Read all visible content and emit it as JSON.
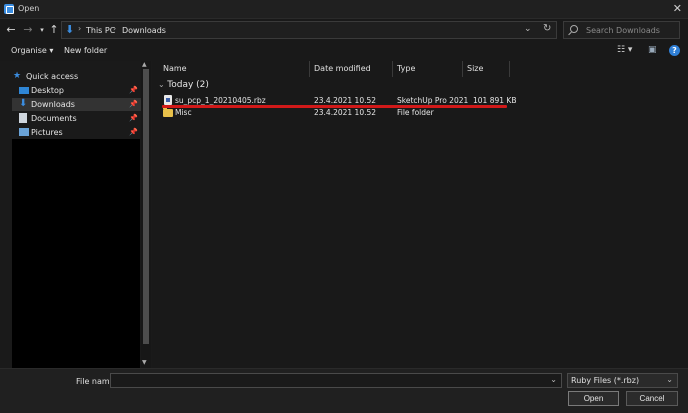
{
  "window": {
    "title": "Open"
  },
  "address": {
    "segments": [
      "This PC",
      "Downloads"
    ]
  },
  "search": {
    "placeholder": "Search Downloads"
  },
  "toolbar": {
    "organise": "Organise ▾",
    "new_folder": "New folder"
  },
  "sidebar": {
    "quick_access": "Quick access",
    "items": [
      {
        "label": "Desktop",
        "icon": "desktop-icon",
        "pinned": true
      },
      {
        "label": "Downloads",
        "icon": "download-arrow-icon",
        "pinned": true,
        "selected": true
      },
      {
        "label": "Documents",
        "icon": "document-icon",
        "pinned": true
      },
      {
        "label": "Pictures",
        "icon": "pictures-icon",
        "pinned": true
      }
    ]
  },
  "columns": {
    "name": "Name",
    "date": "Date modified",
    "type": "Type",
    "size": "Size"
  },
  "group": {
    "label": "Today (2)"
  },
  "files": [
    {
      "name": "su_pcp_1_20210405.rbz",
      "date": "23.4.2021 10.52",
      "type": "SketchUp Pro 2021",
      "size": "101 891 KB",
      "icon": "file-icon"
    },
    {
      "name": "Misc",
      "date": "23.4.2021 10.52",
      "type": "File folder",
      "size": "",
      "icon": "folder-icon"
    }
  ],
  "bottom": {
    "file_name_label": "File name:",
    "file_name_value": "",
    "file_type": "Ruby Files (*.rbz)",
    "open_label": "Open",
    "cancel_label": "Cancel"
  },
  "colors": {
    "accent": "#3b8de0",
    "highlight_line": "#d11919",
    "folder": "#e8c04a"
  }
}
